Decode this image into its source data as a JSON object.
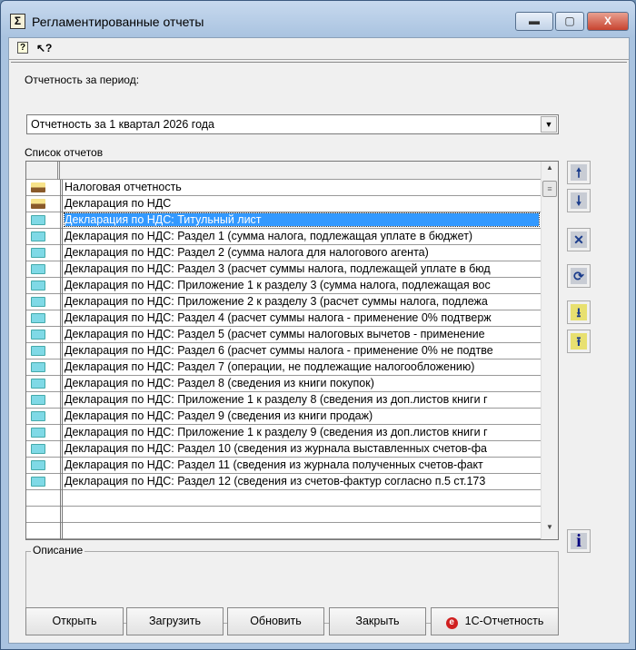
{
  "window": {
    "title": "Регламентированные отчеты",
    "minimize": "▬",
    "maximize": "▢",
    "close": "X"
  },
  "toolbar": {
    "help_icon": "?",
    "context_help_icon": "↖?"
  },
  "period": {
    "label": "Отчетность за период:",
    "value": "Отчетность за 1 квартал 2026 года"
  },
  "list": {
    "label": "Список отчетов",
    "selected_index": 2,
    "items": [
      {
        "icon": "folder-group",
        "text": "Налоговая отчетность"
      },
      {
        "icon": "folder-group",
        "text": "Декларация по НДС"
      },
      {
        "icon": "report",
        "text": "Декларация по НДС: Титульный лист"
      },
      {
        "icon": "report",
        "text": "Декларация по НДС: Раздел 1 (сумма налога, подлежащая уплате в бюджет)"
      },
      {
        "icon": "report",
        "text": "Декларация по НДС: Раздел 2 (сумма налога для налогового агента)"
      },
      {
        "icon": "report",
        "text": "Декларация по НДС: Раздел 3 (расчет суммы налога, подлежащей уплате в бюд"
      },
      {
        "icon": "report",
        "text": "Декларация по НДС: Приложение 1 к разделу 3 (сумма налога, подлежащая вос"
      },
      {
        "icon": "report",
        "text": "Декларация по НДС: Приложение 2 к разделу 3 (расчет суммы налога, подлежа"
      },
      {
        "icon": "report",
        "text": "Декларация по НДС: Раздел 4 (расчет суммы налога - применение 0% подтверж"
      },
      {
        "icon": "report",
        "text": "Декларация по НДС: Раздел 5 (расчет суммы налоговых вычетов - применение"
      },
      {
        "icon": "report",
        "text": "Декларация по НДС: Раздел 6 (расчет суммы налога - применение 0% не подтве"
      },
      {
        "icon": "report",
        "text": "Декларация по НДС: Раздел 7 (операции, не подлежащие налогообложению)"
      },
      {
        "icon": "report",
        "text": "Декларация по НДС: Раздел 8 (сведения из книги покупок)"
      },
      {
        "icon": "report",
        "text": "Декларация по НДС: Приложение 1 к разделу 8 (сведения из доп.листов книги г"
      },
      {
        "icon": "report",
        "text": "Декларация по НДС: Раздел 9 (сведения из книги продаж)"
      },
      {
        "icon": "report",
        "text": "Декларация по НДС: Приложение 1 к разделу 9 (сведения из доп.листов книги г"
      },
      {
        "icon": "report",
        "text": "Декларация по НДС: Раздел 10 (сведения из журнала выставленных счетов-фа"
      },
      {
        "icon": "report",
        "text": "Декларация по НДС: Раздел 11 (сведения из журнала полученных счетов-факт"
      },
      {
        "icon": "report",
        "text": "Декларация по НДС: Раздел 12 (сведения из счетов-фактур согласно п.5 ст.173"
      }
    ]
  },
  "side_buttons": {
    "up": "🠕",
    "down": "🠗",
    "delete": "✕",
    "refresh": "⟳",
    "save_in": "⭳",
    "save_out": "⭱",
    "info": "i"
  },
  "description": {
    "label": "Описание"
  },
  "buttons": {
    "open": "Открыть",
    "load": "Загрузить",
    "update": "Обновить",
    "close": "Закрыть",
    "reporting": "1С-Отчетность",
    "reporting_icon": "e"
  }
}
